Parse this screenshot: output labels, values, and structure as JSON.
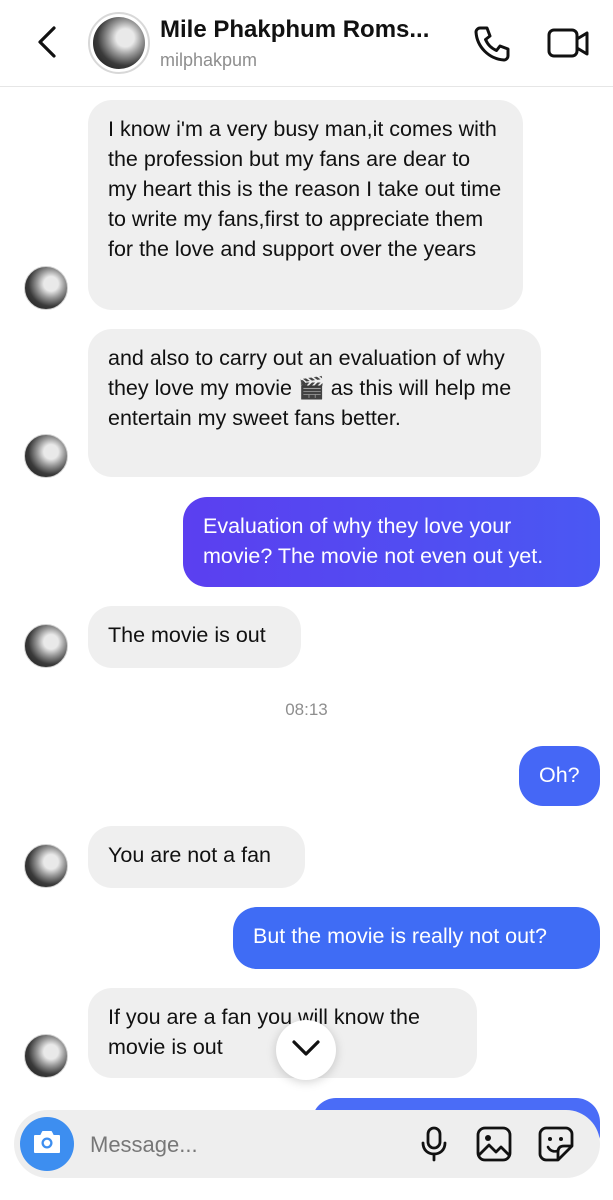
{
  "header": {
    "name": "Mile Phakphum Roms...",
    "username": "milphakpum",
    "icons": [
      "back-arrow",
      "phone-call",
      "video-call"
    ]
  },
  "messages": [
    {
      "from": "them",
      "text": "I know i'm a very busy man,it comes with the profession but my fans are dear to my heart this is the reason I take out time to write my fans,first to appreciate them for the love and support over the years"
    },
    {
      "from": "them",
      "text": "and also to carry out an evaluation of why they love my movie 🎬 as this will help me entertain my sweet fans better."
    },
    {
      "from": "me",
      "text": "Evaluation of why they love your movie? The movie not even out yet."
    },
    {
      "from": "them",
      "text": "The movie is out"
    },
    {
      "from": "me",
      "text": "Oh?"
    },
    {
      "from": "them",
      "text": "You are not a fan"
    },
    {
      "from": "me",
      "text": "But the movie is really not out?"
    },
    {
      "from": "them",
      "text": "If you are a fan you will know the movie is out"
    }
  ],
  "timestamp": "08:13",
  "composer": {
    "placeholder": "Message...",
    "icons": [
      "camera",
      "microphone",
      "gallery",
      "sticker"
    ]
  },
  "colors": {
    "received_bubble": "#efefef",
    "sent_gradient_purple": "#5b3ff0",
    "sent_gradient_blue": "#3f6cf5",
    "camera_button": "#3d8ef0"
  }
}
